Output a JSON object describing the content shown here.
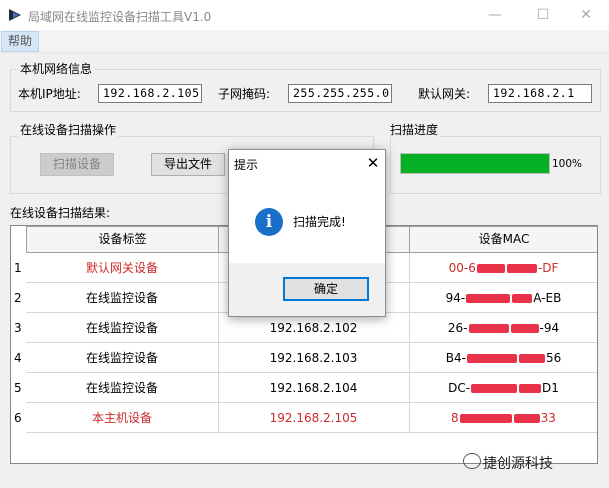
{
  "window": {
    "title": "局域网在线监控设备扫描工具V1.0",
    "controls": [
      "—",
      "☐",
      "✕"
    ]
  },
  "menu": {
    "items": [
      "帮助"
    ]
  },
  "local_info": {
    "group_title": "本机网络信息",
    "ip_label": "本机IP地址:",
    "ip_value": "192.168.2.105",
    "mask_label": "子网掩码:",
    "mask_value": "255.255.255.0",
    "gateway_label": "默认网关:",
    "gateway_value": "192.168.2.1"
  },
  "scan_ops": {
    "group_title": "在线设备扫描操作",
    "scan_button": "扫描设备",
    "export_button": "导出文件"
  },
  "progress": {
    "group_title": "扫描进度",
    "value": 1.0,
    "label": "100%"
  },
  "results": {
    "title": "在线设备扫描结果:",
    "columns": [
      "设备标签",
      "",
      "设备MAC"
    ],
    "rows": [
      {
        "num": "1",
        "label": "默认网关设备",
        "ip": "",
        "mac_prefix": "00-6",
        "mac_suffix": "-DF",
        "highlight": true
      },
      {
        "num": "2",
        "label": "在线监控设备",
        "ip": "",
        "mac_prefix": "94-",
        "mac_suffix": "A-EB",
        "highlight": false
      },
      {
        "num": "3",
        "label": "在线监控设备",
        "ip": "192.168.2.102",
        "mac_prefix": "26-",
        "mac_suffix": "-94",
        "highlight": false
      },
      {
        "num": "4",
        "label": "在线监控设备",
        "ip": "192.168.2.103",
        "mac_prefix": "B4-",
        "mac_suffix": "56",
        "highlight": false
      },
      {
        "num": "5",
        "label": "在线监控设备",
        "ip": "192.168.2.104",
        "mac_prefix": "DC-",
        "mac_suffix": "D1",
        "highlight": false
      },
      {
        "num": "6",
        "label": "本主机设备",
        "ip": "192.168.2.105",
        "mac_prefix": "8",
        "mac_suffix": "33",
        "highlight": true
      }
    ]
  },
  "dialog": {
    "title": "提示",
    "message": "扫描完成!",
    "ok_button": "确定",
    "close": "✕",
    "info_glyph": "i"
  },
  "watermark": {
    "text": "捷创源科技",
    "icon": "wechat-icon"
  },
  "colors": {
    "accent": "#0078d7",
    "progress": "#06b025",
    "highlight_text": "#cc2b2b",
    "redaction": "#e8324a"
  }
}
